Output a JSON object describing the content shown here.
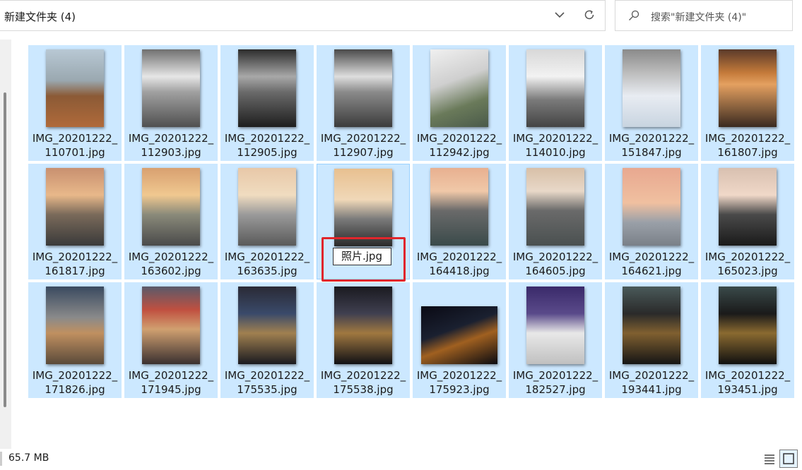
{
  "address_bar": {
    "path": "新建文件夹 (4)"
  },
  "search": {
    "placeholder": "搜索\"新建文件夹 (4)\""
  },
  "files": [
    {
      "line1": "IMG_20201222_",
      "line2": "110701.jpg",
      "bg": "linear-gradient(180deg,#b8c8d4 0%,#9aa8b0 40%,#8b5a36 60%,#b06a3a 100%)",
      "orientation": "portrait"
    },
    {
      "line1": "IMG_20201222_",
      "line2": "112903.jpg",
      "bg": "linear-gradient(180deg,#707070 0%,#e6e6e6 35%,#a0a0a0 55%,#505050 100%)",
      "orientation": "portrait"
    },
    {
      "line1": "IMG_20201222_",
      "line2": "112905.jpg",
      "bg": "linear-gradient(180deg,#2c2c2c 0%,#a8a8a8 35%,#6a6a6a 55%,#1e1e1e 100%)",
      "orientation": "portrait"
    },
    {
      "line1": "IMG_20201222_",
      "line2": "112907.jpg",
      "bg": "linear-gradient(180deg,#4a4a4a 0%,#dedede 35%,#8a8a8a 55%,#3c3c3c 100%)",
      "orientation": "portrait"
    },
    {
      "line1": "IMG_20201222_",
      "line2": "112942.jpg",
      "bg": "linear-gradient(160deg,#f0f0f0 0%,#cfcfcf 40%,#6a7a5a 70%,#4a5a4a 100%)",
      "orientation": "portrait"
    },
    {
      "line1": "IMG_20201222_",
      "line2": "114010.jpg",
      "bg": "linear-gradient(180deg,#d8d8d8 0%,#f2f2f2 35%,#7a7a7a 65%,#444 100%)",
      "orientation": "portrait"
    },
    {
      "line1": "IMG_20201222_",
      "line2": "151847.jpg",
      "bg": "linear-gradient(180deg,#8a8a8a 0%,#bcbcbc 30%,#e8ecf2 60%,#c8d4e0 100%)",
      "orientation": "portrait"
    },
    {
      "line1": "IMG_20201222_",
      "line2": "161807.jpg",
      "bg": "linear-gradient(180deg,#5a3a2a 0%,#c47a3a 30%,#e4a060 45%,#3a2a20 100%)",
      "orientation": "portrait"
    },
    {
      "line1": "IMG_20201222_",
      "line2": "161817.jpg",
      "bg": "linear-gradient(180deg,#c89070 0%,#e8b88a 35%,#7a6a5a 60%,#3a3a3a 100%)",
      "orientation": "portrait"
    },
    {
      "line1": "IMG_20201222_",
      "line2": "163602.jpg",
      "bg": "linear-gradient(180deg,#d8a070 0%,#f0c890 35%,#8a8a7a 60%,#4a4a4a 100%)",
      "orientation": "portrait"
    },
    {
      "line1": "IMG_20201222_",
      "line2": "163635.jpg",
      "bg": "linear-gradient(180deg,#e8c8a8 0%,#f0dcc0 35%,#9a9a9a 60%,#5a5a5a 100%)",
      "orientation": "portrait"
    },
    {
      "line1": "",
      "line2": "",
      "bg": "linear-gradient(180deg,#e8c090 0%,#f0d8b8 40%,#7a7a7a 65%,#2a2a2a 100%)",
      "orientation": "portrait",
      "renaming": true
    },
    {
      "line1": "IMG_20201222_",
      "line2": "164418.jpg",
      "bg": "linear-gradient(180deg,#e8b090 0%,#f0c8a8 30%,#6a6a6a 55%,#3a4a4a 100%)",
      "orientation": "portrait"
    },
    {
      "line1": "IMG_20201222_",
      "line2": "164605.jpg",
      "bg": "linear-gradient(180deg,#d8c0a8 0%,#e8d8c8 30%,#6a6a6a 55%,#4a5050 100%)",
      "orientation": "portrait"
    },
    {
      "line1": "IMG_20201222_",
      "line2": "164621.jpg",
      "bg": "linear-gradient(180deg,#e8a890 0%,#f0c0a0 45%,#9aa0a8 70%,#7a8088 100%)",
      "orientation": "portrait"
    },
    {
      "line1": "IMG_20201222_",
      "line2": "165023.jpg",
      "bg": "linear-gradient(180deg,#d8c0b0 0%,#f0d8c8 35%,#4a4a4a 60%,#1a1a1a 100%)",
      "orientation": "portrait"
    },
    {
      "line1": "IMG_20201222_",
      "line2": "171826.jpg",
      "bg": "linear-gradient(180deg,#3a4a60 0%,#8a8a8a 40%,#c09060 60%,#5a4a3a 100%)",
      "orientation": "portrait"
    },
    {
      "line1": "IMG_20201222_",
      "line2": "171945.jpg",
      "bg": "linear-gradient(180deg,#5a5a6a 0%,#c05040 30%,#d0a070 55%,#3a3030 100%)",
      "orientation": "portrait"
    },
    {
      "line1": "IMG_20201222_",
      "line2": "175535.jpg",
      "bg": "linear-gradient(180deg,#2a2a35 0%,#3a4a6a 35%,#a08050 60%,#1a1a20 100%)",
      "orientation": "portrait"
    },
    {
      "line1": "IMG_20201222_",
      "line2": "175538.jpg",
      "bg": "linear-gradient(180deg,#1a1a20 0%,#404050 35%,#a07840 60%,#101015 100%)",
      "orientation": "portrait"
    },
    {
      "line1": "IMG_20201222_",
      "line2": "175923.jpg",
      "bg": "linear-gradient(160deg,#0a0a14 0%,#1a2030 40%,#a06020 60%,#0a0a10 100%)",
      "orientation": "landscape"
    },
    {
      "line1": "IMG_20201222_",
      "line2": "182527.jpg",
      "bg": "linear-gradient(180deg,#3a2a6a 0%,#5a4a8a 35%,#e8e8e8 60%,#c0c0c0 100%)",
      "orientation": "portrait"
    },
    {
      "line1": "IMG_20201222_",
      "line2": "193441.jpg",
      "bg": "linear-gradient(180deg,#4a5a5a 0%,#2a2a2a 35%,#806030 60%,#151515 100%)",
      "orientation": "portrait"
    },
    {
      "line1": "IMG_20201222_",
      "line2": "193451.jpg",
      "bg": "linear-gradient(180deg,#3a4a4a 0%,#1a1a1a 35%,#8a6a30 60%,#101010 100%)",
      "orientation": "portrait"
    }
  ],
  "rename": {
    "value": "照片.jpg"
  },
  "status": {
    "size": "65.7 MB"
  },
  "colors": {
    "selection": "#cce8ff",
    "highlight": "#e0262c"
  }
}
